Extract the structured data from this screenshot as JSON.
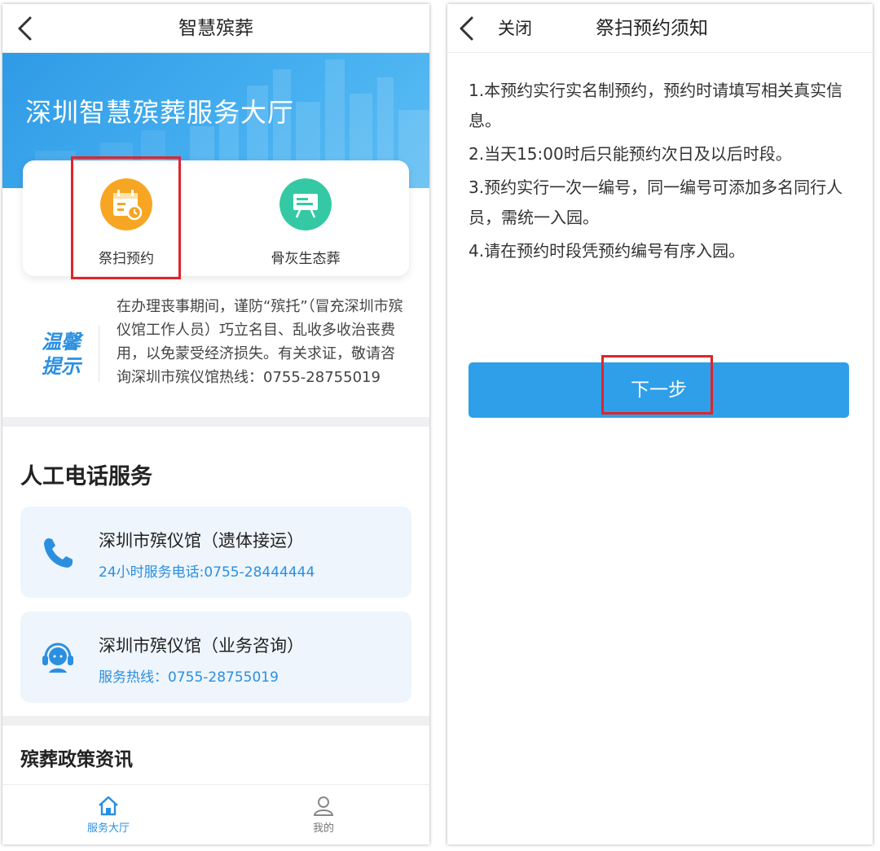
{
  "left_screen": {
    "header": {
      "title": "智慧殡葬"
    },
    "banner": {
      "title": "深圳智慧殡葬服务大厅"
    },
    "services": [
      {
        "label": "祭扫预约",
        "icon": "calendar-icon",
        "color": "#f6a623",
        "highlighted": true
      },
      {
        "label": "骨灰生态葬",
        "icon": "board-icon",
        "color": "#34c9a4",
        "highlighted": false
      }
    ],
    "notice": {
      "logo_line1": "温馨",
      "logo_line2": "提示",
      "text": "在办理丧事期间，谨防“殡托”（冒充深圳市殡仪馆工作人员）巧立名目、乱收多收治丧费用，以免蒙受经济损失。有关求证，敬请咨询深圳市殡仪馆热线：0755-28755019"
    },
    "phone_section": {
      "title": "人工电话服务",
      "items": [
        {
          "name": "深圳市殡仪馆（遗体接运）",
          "number": "24小时服务电话:0755-28444444",
          "icon": "phone-icon"
        },
        {
          "name": "深圳市殡仪馆（业务咨询）",
          "number": "服务热线：0755-28755019",
          "icon": "headset-icon"
        }
      ]
    },
    "policy_section": {
      "title": "殡葬政策资讯"
    },
    "tabbar": [
      {
        "label": "服务大厅",
        "icon": "home-icon",
        "active": true
      },
      {
        "label": "我的",
        "icon": "user-icon",
        "active": false
      }
    ]
  },
  "right_screen": {
    "header": {
      "close_label": "关闭",
      "title": "祭扫预约须知"
    },
    "items": [
      "1.本预约实行实名制预约，预约时请填写相关真实信息。",
      "2.当天15:00时后只能预约次日及以后时段。",
      "3.预约实行一次一编号，同一编号可添加多名同行人员，需统一入园。",
      "4.请在预约时段凭预约编号有序入园。"
    ],
    "next_button": "下一步"
  },
  "colors": {
    "accent": "#2e9fe8",
    "highlight_box": "#e0242b",
    "text_blue": "#2b8fe0"
  }
}
